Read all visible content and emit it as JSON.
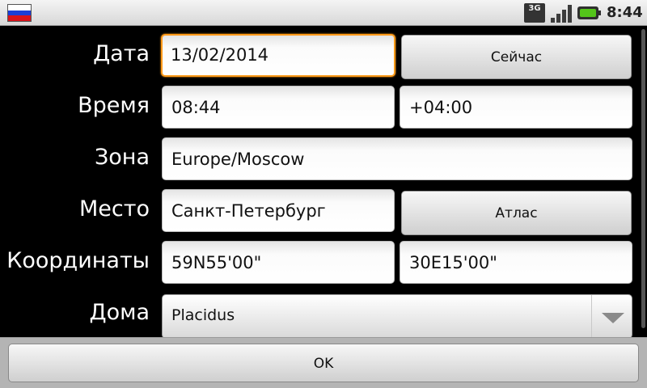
{
  "status_bar": {
    "flag_icon": "russian-flag-icon",
    "network_label": "3G",
    "signal_icon": "signal-icon",
    "battery_icon": "battery-charging-icon",
    "time": "8:44"
  },
  "form": {
    "date": {
      "label": "Дата",
      "value": "13/02/2014",
      "button": "Сейчас"
    },
    "time": {
      "label": "Время",
      "value": "08:44",
      "offset": "+04:00"
    },
    "zone": {
      "label": "Зона",
      "value": "Europe/Moscow"
    },
    "place": {
      "label": "Место",
      "value": "Санкт-Петербург",
      "button": "Атлас"
    },
    "coordinates": {
      "label": "Координаты",
      "latitude": "59N55'00\"",
      "longitude": "30E15'00\""
    },
    "houses": {
      "label": "Дома",
      "selected": "Placidus"
    }
  },
  "footer": {
    "ok_label": "OK"
  },
  "colors": {
    "focus": "#ff9b1a",
    "background": "#000000"
  }
}
